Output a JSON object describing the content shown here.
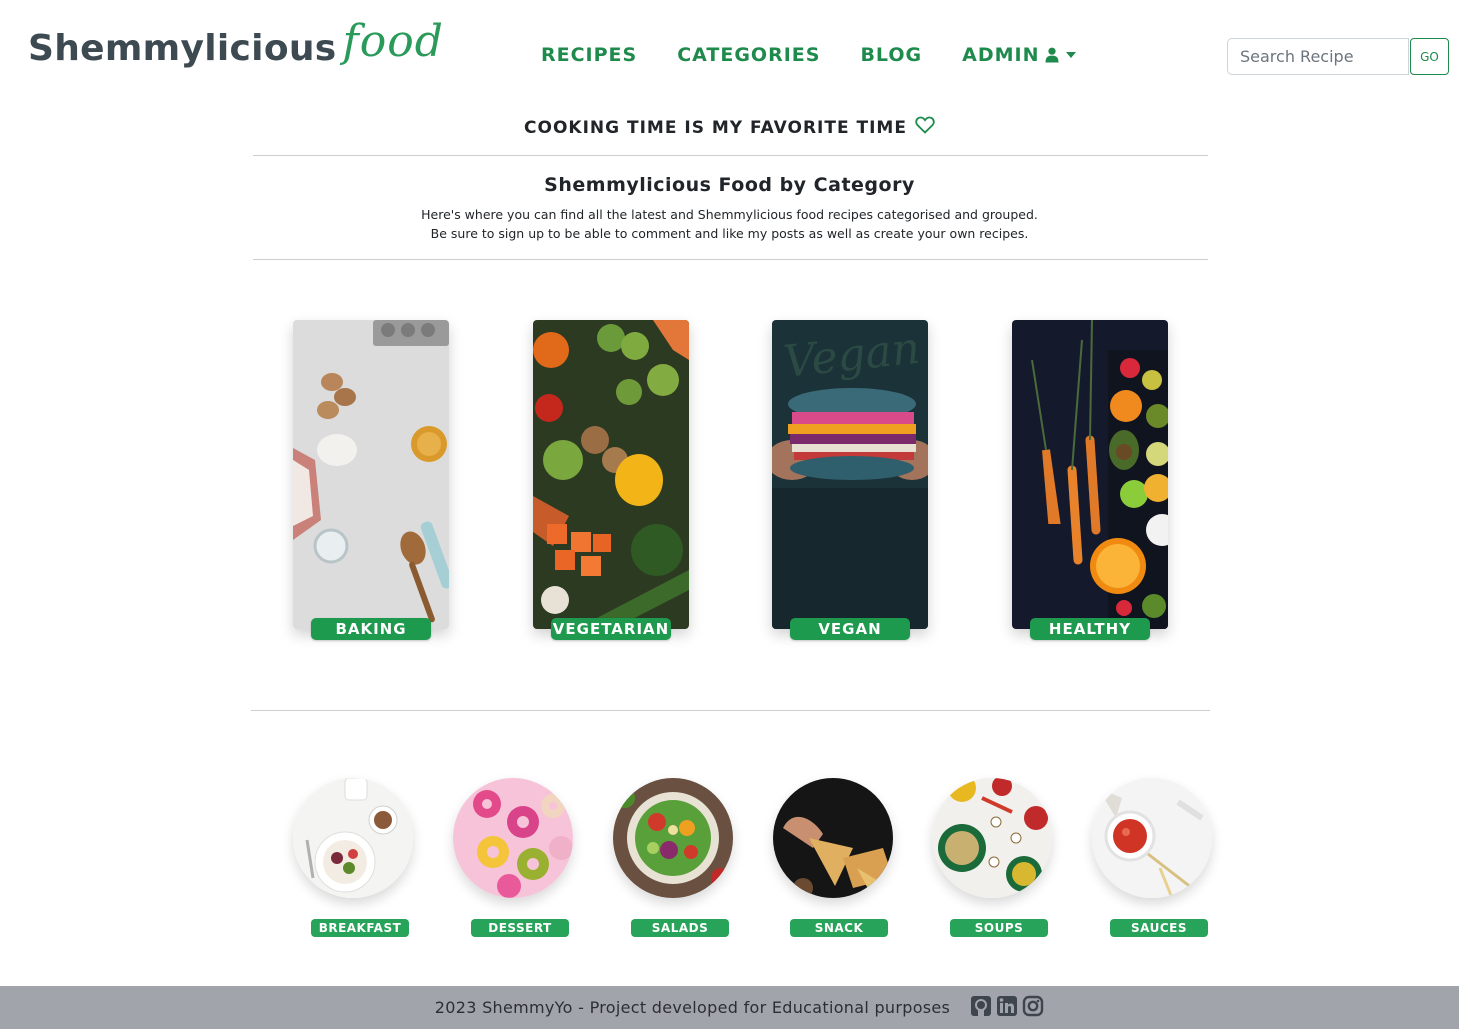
{
  "brand": {
    "main": "Shemmylicious",
    "script": "food"
  },
  "nav": {
    "recipes": "RECIPES",
    "categories": "CATEGORIES",
    "blog": "BLOG",
    "admin": "ADMIN"
  },
  "search": {
    "placeholder": "Search Recipe",
    "button": "GO"
  },
  "tagline": "COOKING TIME IS MY FAVORITE TIME",
  "section": {
    "title": "Shemmylicious Food by Category",
    "desc_line1": "Here's where you can find all the latest and Shemmylicious food recipes categorised and grouped.",
    "desc_line2": "Be sure to sign up to be able to comment and like my posts as well as create your own recipes."
  },
  "main_categories": [
    {
      "label": "BAKING"
    },
    {
      "label": "VEGETARIAN"
    },
    {
      "label": "VEGAN"
    },
    {
      "label": "HEALTHY"
    }
  ],
  "sub_categories": [
    {
      "label": "BREAKFAST"
    },
    {
      "label": "DESSERT"
    },
    {
      "label": "SALADS"
    },
    {
      "label": "SNACK"
    },
    {
      "label": "SOUPS"
    },
    {
      "label": "SAUCES"
    }
  ],
  "footer": {
    "text": "2023 ShemmyYo - Project developed for Educational purposes",
    "icons": [
      "github-icon",
      "linkedin-icon",
      "instagram-icon"
    ]
  },
  "colors": {
    "accent": "#1e8a4c",
    "badge": "#1e9a4e",
    "footer_bg": "#a2a4ab",
    "brand_text": "#3d4a52"
  }
}
